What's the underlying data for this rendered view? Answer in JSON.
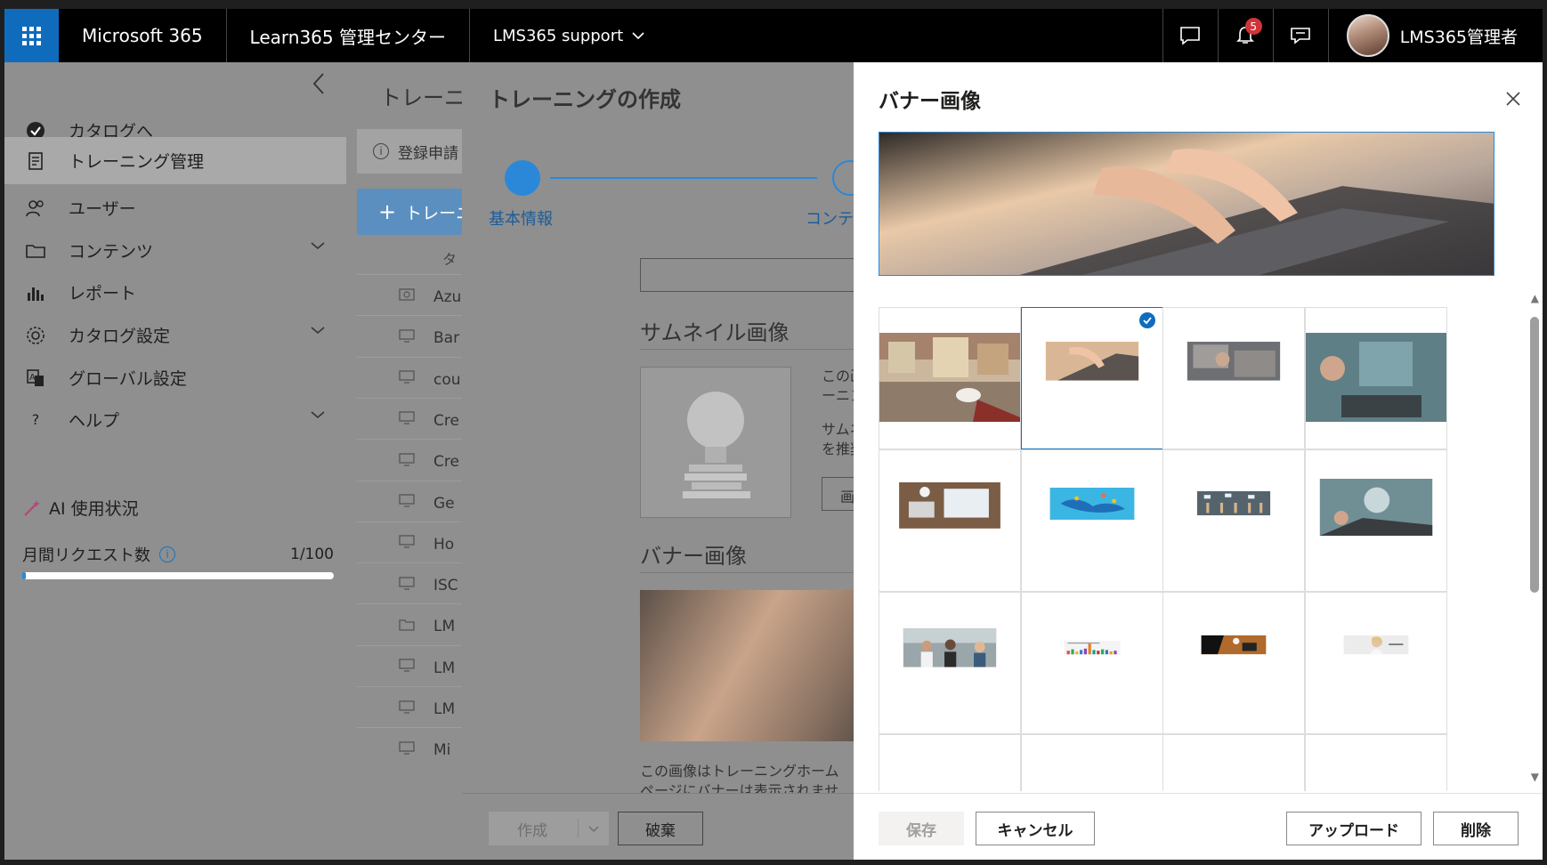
{
  "topbar": {
    "app_name": "Microsoft 365",
    "admin_center": "Learn365 管理センター",
    "tenant": "LMS365 support",
    "notification_count": "5",
    "user_name": "LMS365管理者"
  },
  "sidebar": {
    "items": [
      {
        "label": "カタログへ",
        "icon": "check-circle-icon"
      },
      {
        "label": "トレーニング管理",
        "icon": "document-icon"
      },
      {
        "label": "ユーザー",
        "icon": "people-icon"
      },
      {
        "label": "コンテンツ",
        "icon": "folder-icon"
      },
      {
        "label": "レポート",
        "icon": "bar-chart-icon"
      },
      {
        "label": "カタログ設定",
        "icon": "gear-icon"
      },
      {
        "label": "グローバル設定",
        "icon": "translate-icon"
      },
      {
        "label": "ヘルプ",
        "icon": "question-icon"
      }
    ],
    "ai_label": "AI 使用状況",
    "requests_label": "月間リクエスト数",
    "requests_count": "1/100",
    "requests_fraction": 0.01
  },
  "background_list": {
    "title": "トレーニ",
    "info": "登録申請",
    "new_button": "トレーニ",
    "column_head": "タ",
    "rows": [
      "Azu",
      "Bar",
      "cou",
      "Cre",
      "Cre",
      "Ge",
      "Ho",
      "ISC",
      "LM",
      "LM",
      "LM",
      "Mi"
    ]
  },
  "create_panel": {
    "title": "トレーニングの作成",
    "step1": "基本情報",
    "step2": "コンテ",
    "thumbnail_heading": "サムネイル画像",
    "thumbnail_desc_1": "この画",
    "thumbnail_desc_2": "ーニン",
    "thumbnail_desc_3": "サムネ",
    "thumbnail_desc_4": "を推奨",
    "thumbnail_button": "画",
    "banner_heading": "バナー画像",
    "banner_desc_1": "この画像はトレーニングホーム",
    "banner_desc_2": "ページにバナーは表示されませ",
    "create_button": "作成",
    "discard_button": "破棄"
  },
  "banner_dialog": {
    "title": "バナー画像",
    "save_button": "保存",
    "cancel_button": "キャンセル",
    "upload_button": "アップロード",
    "delete_button": "削除",
    "selected_index": 1,
    "images": [
      "city-coffee-image",
      "laptop-typing-image",
      "laptop-hands-image",
      "tech-hologram-image",
      "desk-laptop-image",
      "world-map-image",
      "people-chat-image",
      "elearning-image",
      "team-highfive-image",
      "chart-banner-image",
      "desk-coffee-image",
      "learn-like-you-image"
    ]
  }
}
